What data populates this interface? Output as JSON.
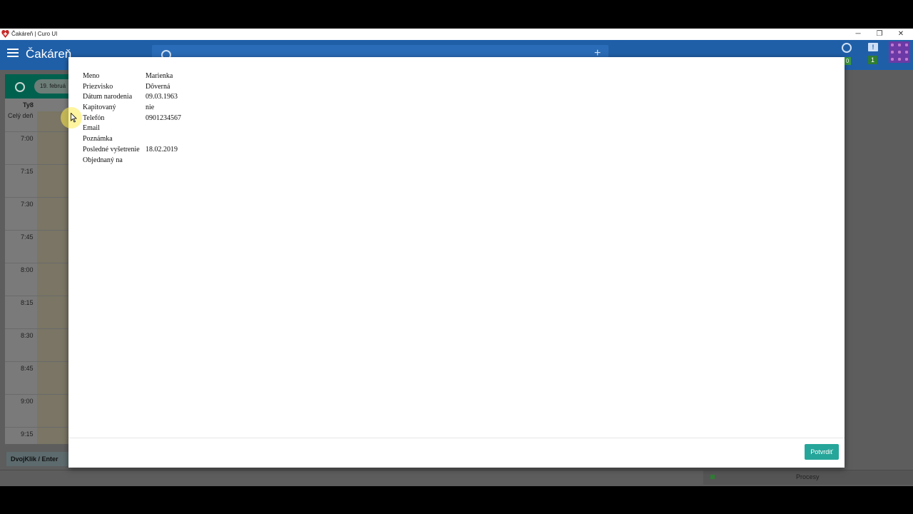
{
  "window": {
    "title": "Čakáreň | Curo UI",
    "minimize": "─",
    "restore": "❐",
    "close": "✕"
  },
  "appbar": {
    "title": "Čakáreň",
    "add": "+",
    "sync_badge": "0",
    "msg_icon": "!",
    "msg_badge": "1"
  },
  "calendar": {
    "date_chip": "19. februá",
    "day": "Ty8",
    "all_day": "Celý deň",
    "times": [
      "7:00",
      "7:15",
      "7:30",
      "7:45",
      "8:00",
      "8:15",
      "8:30",
      "8:45",
      "9:00",
      "9:15"
    ]
  },
  "hint": "DvojKlik / Enter",
  "status": {
    "procesy": "Procesy"
  },
  "modal": {
    "rows": [
      {
        "label": "Meno",
        "value": "Marienka"
      },
      {
        "label": "Priezvisko",
        "value": "Dôverná"
      },
      {
        "label": "Dátum narodenia",
        "value": "09.03.1963"
      },
      {
        "label": "Kapitovaný",
        "value": "nie"
      },
      {
        "label": "Telefón",
        "value": "0901234567"
      },
      {
        "label": "Email",
        "value": ""
      },
      {
        "label": "Poznámka",
        "value": ""
      },
      {
        "label": "Posledné vyšetrenie",
        "value": "18.02.2019"
      },
      {
        "label": "Objednaný na",
        "value": ""
      }
    ],
    "confirm_label": "Potvrdiť"
  },
  "colors": {
    "appbar": "#1f5fa8",
    "calendar_header": "#00614f",
    "confirm": "#26a69a"
  },
  "icons": [
    "menu-icon",
    "search-icon",
    "add-icon",
    "sync-icon",
    "message-icon",
    "avatar",
    "clock-icon",
    "app-heart-icon"
  ]
}
